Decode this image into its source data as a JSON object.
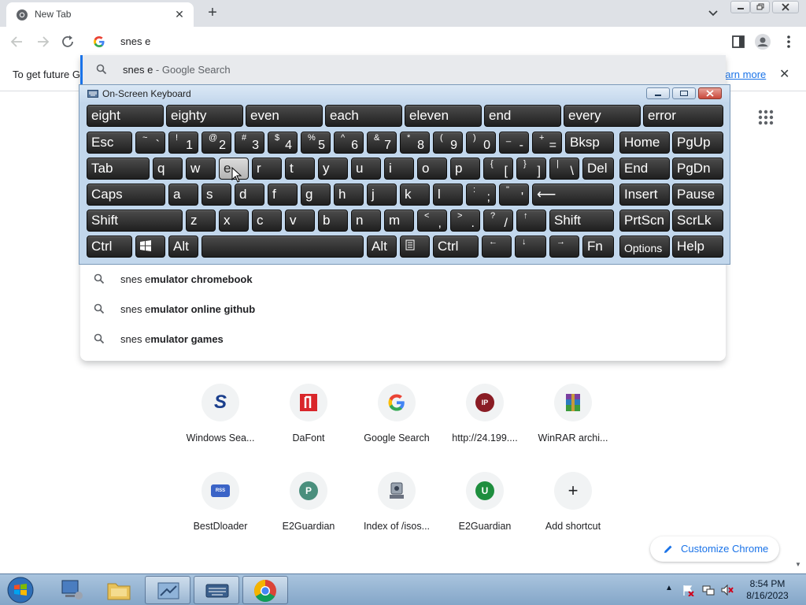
{
  "browser": {
    "tab_title": "New Tab",
    "omnibox_text": "snes e",
    "banner_text": "To get future G",
    "banner_link": "earn more"
  },
  "dropdown": {
    "first": {
      "query": "snes e",
      "suffix": " - Google Search"
    },
    "suggestions": [
      {
        "prefix": "snes e",
        "bold": "mulator chromebook"
      },
      {
        "prefix": "snes e",
        "bold": "mulator online github"
      },
      {
        "prefix": "snes e",
        "bold": "mulator games"
      }
    ]
  },
  "osk": {
    "title": "On-Screen Keyboard",
    "predictions": [
      "eight",
      "eighty",
      "even",
      "each",
      "eleven",
      "end",
      "every",
      "error"
    ],
    "row1": {
      "esc": "Esc",
      "keys": [
        {
          "top": "~",
          "bottom": "`"
        },
        {
          "top": "!",
          "bottom": "1"
        },
        {
          "top": "@",
          "bottom": "2"
        },
        {
          "top": "#",
          "bottom": "3"
        },
        {
          "top": "$",
          "bottom": "4"
        },
        {
          "top": "%",
          "bottom": "5"
        },
        {
          "top": "^",
          "bottom": "6"
        },
        {
          "top": "&",
          "bottom": "7"
        },
        {
          "top": "*",
          "bottom": "8"
        },
        {
          "top": "(",
          "bottom": "9"
        },
        {
          "top": ")",
          "bottom": "0"
        },
        {
          "top": "_",
          "bottom": "-"
        },
        {
          "top": "+",
          "bottom": "="
        }
      ],
      "bksp": "Bksp"
    },
    "row2": {
      "tab": "Tab",
      "letters": [
        "q",
        "w",
        "e",
        "r",
        "t",
        "y",
        "u",
        "i",
        "o",
        "p"
      ],
      "brackets": [
        {
          "top": "{",
          "bottom": "["
        },
        {
          "top": "}",
          "bottom": "]"
        },
        {
          "top": "|",
          "bottom": "\\"
        }
      ],
      "del": "Del"
    },
    "row3": {
      "caps": "Caps",
      "letters": [
        "a",
        "s",
        "d",
        "f",
        "g",
        "h",
        "j",
        "k",
        "l"
      ],
      "punct": [
        {
          "top": ":",
          "bottom": ";"
        },
        {
          "top": "\"",
          "bottom": "'"
        }
      ],
      "enter": "⟵"
    },
    "row4": {
      "shift_left": "Shift",
      "letters": [
        "z",
        "x",
        "c",
        "v",
        "b",
        "n",
        "m"
      ],
      "punct": [
        {
          "top": "<",
          "bottom": ","
        },
        {
          "top": ">",
          "bottom": "."
        },
        {
          "top": "?",
          "bottom": "/"
        }
      ],
      "up": "↑",
      "shift_right": "Shift"
    },
    "row5": {
      "ctrl_left": "Ctrl",
      "alt_left": "Alt",
      "alt_right": "Alt",
      "ctrl_right": "Ctrl",
      "left": "←",
      "down": "↓",
      "right": "→",
      "fn": "Fn"
    },
    "nav": [
      "Home",
      "PgUp",
      "End",
      "PgDn",
      "Insert",
      "Pause",
      "PrtScn",
      "ScrLk",
      "Options",
      "Help"
    ],
    "pressed_key": "e"
  },
  "shortcuts": [
    {
      "label": "Windows Sea...",
      "letter": "S",
      "color": "#1a3e8c"
    },
    {
      "label": "DaFont",
      "letter": "",
      "color": "#d9262a"
    },
    {
      "label": "Google Search",
      "letter": "G",
      "color": "#4285f4"
    },
    {
      "label": "http://24.199....",
      "letter": "IP",
      "color": "#8a1c24"
    },
    {
      "label": "WinRAR archi...",
      "letter": "",
      "color": "#7a3fa0"
    },
    {
      "label": "BestDloader",
      "letter": "RSS",
      "color": "#3b64c7"
    },
    {
      "label": "E2Guardian",
      "letter": "P",
      "color": "#4a8f7d"
    },
    {
      "label": "Index of /isos...",
      "letter": "",
      "color": "#6b7280"
    },
    {
      "label": "E2Guardian",
      "letter": "U",
      "color": "#1e8e3e"
    },
    {
      "label": "Add shortcut",
      "letter": "+",
      "color": "#202124"
    }
  ],
  "customize_label": "Customize Chrome",
  "taskbar": {
    "time": "8:54 PM",
    "date": "8/16/2023"
  }
}
